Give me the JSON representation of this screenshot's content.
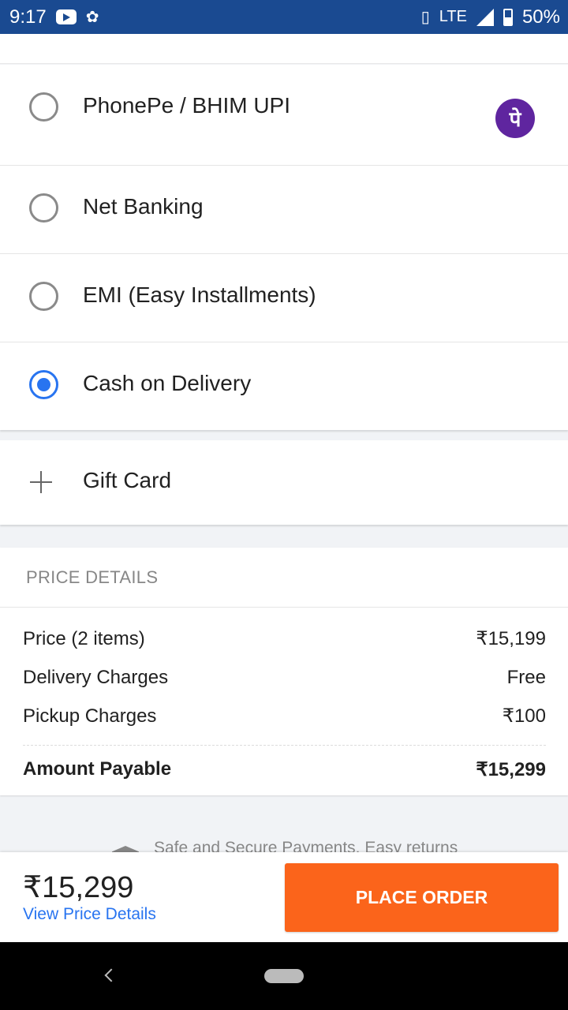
{
  "status_bar": {
    "time": "9:17",
    "network": "LTE",
    "battery": "50%",
    "icons": [
      "youtube-icon",
      "notification-icon",
      "vibrate-icon",
      "signal-icon",
      "battery-icon"
    ]
  },
  "payment_options": [
    {
      "label": "PhonePe / BHIM UPI",
      "selected": false,
      "logo_text": "पे",
      "logo_color": "#5f259f"
    },
    {
      "label": "Net Banking",
      "selected": false
    },
    {
      "label": "EMI (Easy Installments)",
      "selected": false
    },
    {
      "label": "Cash on Delivery",
      "selected": true
    }
  ],
  "gift_card": {
    "label": "Gift Card"
  },
  "price_details": {
    "header": "PRICE DETAILS",
    "rows": [
      {
        "label": "Price (2 items)",
        "value": "₹15,199"
      },
      {
        "label": "Delivery Charges",
        "value": "Free"
      },
      {
        "label": "Pickup Charges",
        "value": "₹100"
      }
    ],
    "total": {
      "label": "Amount Payable",
      "value": "₹15,299"
    }
  },
  "secure_note": "Safe and Secure Payments. Easy returns",
  "bottom_bar": {
    "total": "₹15,299",
    "view_details": "View Price Details",
    "place_order": "PLACE ORDER"
  },
  "colors": {
    "status_bar": "#1a4a91",
    "accent_blue": "#2874f0",
    "place_order": "#fb641b"
  }
}
